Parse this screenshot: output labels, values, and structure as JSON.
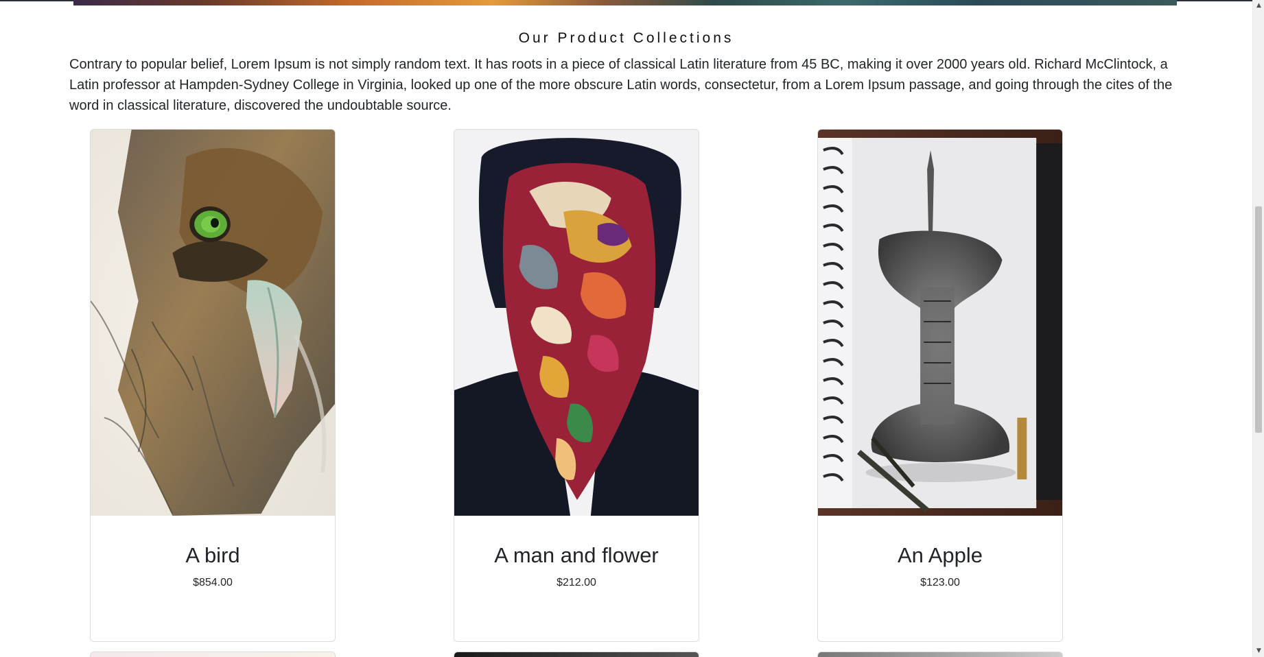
{
  "section": {
    "title": "Our Product Collections",
    "description": "Contrary to popular belief, Lorem Ipsum is not simply random text. It has roots in a piece of classical Latin literature from 45 BC, making it over 2000 years old. Richard McClintock, a Latin professor at Hampden-Sydney College in Virginia, looked up one of the more obscure Latin words, consectetur, from a Lorem Ipsum passage, and going through the cites of the word in classical literature, discovered the undoubtable source."
  },
  "products": [
    {
      "title": "A bird",
      "price": "$854.00",
      "image_icon": "eagle-painting-icon"
    },
    {
      "title": "A man and flower",
      "price": "$212.00",
      "image_icon": "abstract-portrait-icon"
    },
    {
      "title": "An Apple",
      "price": "$123.00",
      "image_icon": "apple-sketch-icon"
    }
  ],
  "scrollbar": {
    "up_arrow": "▲",
    "down_arrow": "▼"
  },
  "colors": {
    "card_border": "#dcdcdc",
    "text": "#212529",
    "scroll_thumb": "#c1c1c1"
  }
}
